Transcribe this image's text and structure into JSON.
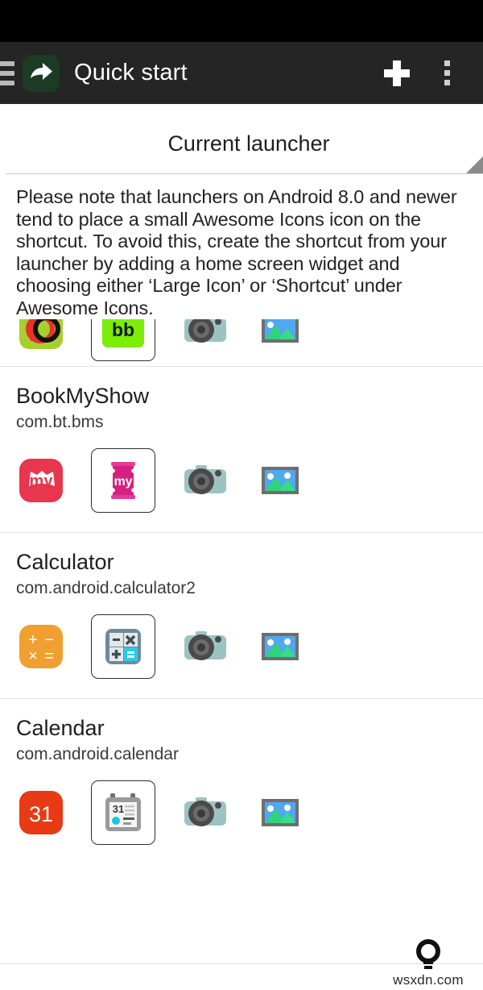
{
  "toolbar": {
    "title": "Quick start",
    "menu_icon": "hamburger-icon",
    "app_icon": "share-arrow-icon",
    "add_label": "+",
    "overflow_label": "⋮"
  },
  "launcher_section": {
    "title": "Current launcher",
    "note": "Please note that launchers on Android 8.0 and newer tend to place a small Awesome Icons icon on the shortcut. To avoid this, create the shortcut from your launcher by adding a home screen widget and choosing either ‘Large Icon’ or ‘Shortcut’ under Awesome Icons."
  },
  "apps": [
    {
      "name": "",
      "package": "",
      "icons": [
        "bb-original-icon",
        "bb-themed-icon",
        "camera-icon",
        "gallery-icon"
      ],
      "selected_index": 1
    },
    {
      "name": "BookMyShow",
      "package": "com.bt.bms",
      "icons": [
        "bookmyshow-original-icon",
        "bookmyshow-themed-icon",
        "camera-icon",
        "gallery-icon"
      ],
      "selected_index": 1
    },
    {
      "name": "Calculator",
      "package": "com.android.calculator2",
      "icons": [
        "calculator-original-icon",
        "calculator-themed-icon",
        "camera-icon",
        "gallery-icon"
      ],
      "selected_index": 1
    },
    {
      "name": "Calendar",
      "package": "com.android.calendar",
      "icons": [
        "calendar-original-icon",
        "calendar-themed-icon",
        "camera-icon",
        "gallery-icon"
      ],
      "selected_index": 1
    }
  ],
  "watermark": {
    "text": "wsxdn.com",
    "icon": "lightbulb-icon"
  },
  "colors": {
    "status_bar": "#000000",
    "toolbar": "#252525",
    "app_icon_bg": "#1d3a24",
    "page_bg": "#ffffff",
    "divider": "#e2e2e2",
    "bookmyshow_red": "#e8364f",
    "bookmyshow_pink": "#d4217f",
    "calculator_orange": "#f0a030",
    "calendar_red": "#e83a15",
    "camera_body": "#9dc2c2",
    "calendar_dot_cyan": "#17c8e0"
  }
}
